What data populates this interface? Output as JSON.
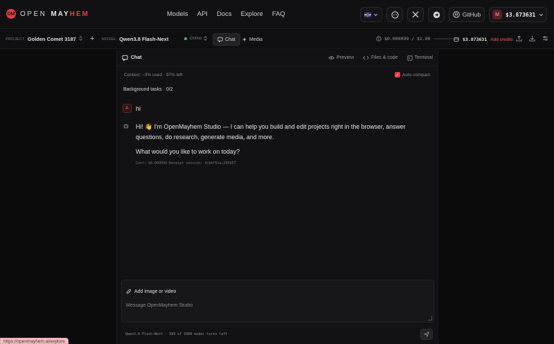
{
  "topnav": {
    "logo_mark": "OM",
    "logo_open": "OPEN",
    "logo_may": "MAY",
    "logo_hem": "HEM",
    "links": [
      "Models",
      "API",
      "Docs",
      "Explore",
      "FAQ"
    ],
    "github_label": "GitHub",
    "account_avatar": "M",
    "account_balance": "$3.873631",
    "icons": [
      "flag-uk-icon",
      "chat-bubble-icon",
      "x-logo-icon",
      "telegram-icon",
      "github-icon"
    ]
  },
  "subbar": {
    "project_caption": "PROJECT",
    "project_name": "Golden Comet 3187",
    "add": "+",
    "model_caption": "MODEL",
    "model_name": "Qwen3.8 Flash-Next",
    "status": "Online",
    "tab_chat": "Chat",
    "tab_media": "Media",
    "cost": "$0.000099 / $1.00",
    "credit_balance": "$3.873631",
    "add_credits": "Add credits"
  },
  "panel": {
    "title": "Chat",
    "preview": "Preview",
    "files": "Files & code",
    "terminal": "Terminal",
    "context": "Context: ~3% used · 97% left",
    "autocompact": "Auto-compact",
    "background_tasks": "Background tasks · 0/2"
  },
  "messages": {
    "user": {
      "avatar": "A",
      "text": "hi"
    },
    "assistant": {
      "p1": "Hi! 👋 I'm OpenMayhem Studio — I can help you build and edit projects right in the browser, answer questions, do research, generate media, and more.",
      "p2": "What would you like to work on today?",
      "cost": "Cost: $0.000099  Receipt session: 4cbbf9ca…205d57"
    }
  },
  "composer": {
    "attach_label": "Add image or video",
    "placeholder": "Message OpenMayhem Studio",
    "value": "",
    "model_turns": "Qwen3.8 Flash-Next · 999 of 1000 model turns left"
  },
  "status_url": "https://openmayhem.ai/explore",
  "colors": {
    "accent": "#e63e45",
    "background": "#0b0b0c",
    "panel": "#121214",
    "online": "#33c46a"
  }
}
